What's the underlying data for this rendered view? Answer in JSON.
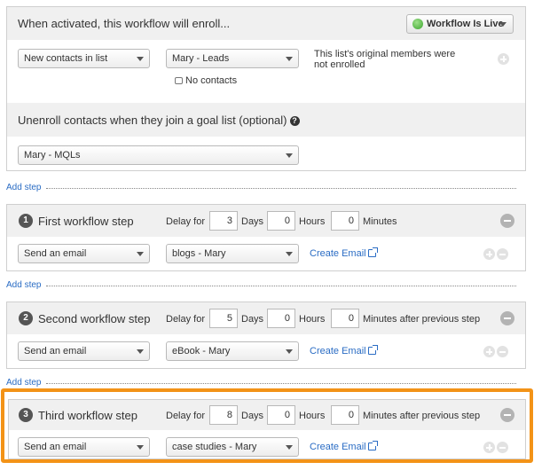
{
  "enroll": {
    "title": "When activated, this workflow will enroll...",
    "status_label": "Workflow Is Live",
    "list_type": "New contacts in list",
    "list_name": "Mary - Leads",
    "contact_count": "No contacts",
    "note": "This list's original members were not enrolled",
    "unenroll_title": "Unenroll contacts when they join a goal list (optional)",
    "help_glyph": "?",
    "goal_list": "Mary - MQLs"
  },
  "add_step_label": "Add step",
  "labels": {
    "delay_for": "Delay for",
    "days": "Days",
    "hours": "Hours",
    "minutes": "Minutes",
    "minutes_after": "Minutes after previous step",
    "create_email": "Create Email"
  },
  "steps": [
    {
      "number": "1",
      "title": "First workflow step",
      "days": "3",
      "hours": "0",
      "minutes": "0",
      "action": "Send an email",
      "email": "blogs - Mary"
    },
    {
      "number": "2",
      "title": "Second workflow step",
      "days": "5",
      "hours": "0",
      "minutes": "0",
      "action": "Send an email",
      "email": "eBook - Mary"
    },
    {
      "number": "3",
      "title": "Third workflow step",
      "days": "8",
      "hours": "0",
      "minutes": "0",
      "action": "Send an email",
      "email": "case studies - Mary"
    }
  ],
  "colors": {
    "highlight": "#f39317",
    "live": "#3aa52c",
    "link": "#2a6cc4"
  }
}
